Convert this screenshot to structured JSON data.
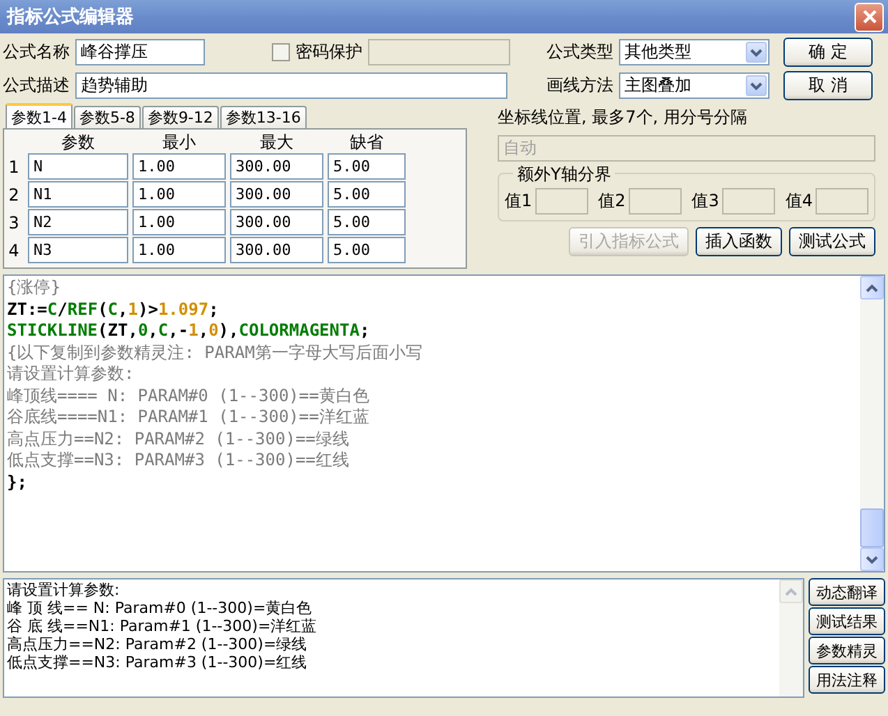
{
  "window": {
    "title": "指标公式编辑器"
  },
  "form": {
    "name_label": "公式名称",
    "name_value": "峰谷撑压",
    "password": {
      "label": "密码保护",
      "checked": false
    },
    "desc_label": "公式描述",
    "desc_value": "趋势辅助",
    "type_label": "公式类型",
    "type_value": "其他类型",
    "draw_label": "画线方法",
    "draw_value": "主图叠加"
  },
  "dialog_buttons": [
    "确 定",
    "取 消"
  ],
  "param_tabs": [
    {
      "label": "参数1-4",
      "selected": true
    },
    {
      "label": "参数5-8",
      "selected": false
    },
    {
      "label": "参数9-12",
      "selected": false
    },
    {
      "label": "参数13-16",
      "selected": false
    }
  ],
  "param_table": {
    "columns": [
      "参数",
      "最小",
      "最大",
      "缺省"
    ],
    "rows": [
      {
        "index": "1",
        "cells": [
          "N",
          "1.00",
          "300.00",
          "5.00"
        ]
      },
      {
        "index": "2",
        "cells": [
          "N1",
          "1.00",
          "300.00",
          "5.00"
        ]
      },
      {
        "index": "3",
        "cells": [
          "N2",
          "1.00",
          "300.00",
          "5.00"
        ]
      },
      {
        "index": "4",
        "cells": [
          "N3",
          "1.00",
          "300.00",
          "5.00"
        ]
      }
    ]
  },
  "axis": {
    "label": "坐标线位置, 最多7个, 用分号分隔",
    "value": "自动",
    "disabled": true
  },
  "y_bounds": {
    "title": "额外Y轴分界",
    "fields": [
      "值1",
      "值2",
      "值3",
      "值4"
    ]
  },
  "action_buttons": [
    {
      "label": "引入指标公式",
      "disabled": true
    },
    {
      "label": "插入函数",
      "disabled": false
    },
    {
      "label": "测试公式",
      "disabled": false
    }
  ],
  "editor": {
    "lines": [
      [
        {
          "kind": "comment",
          "text": "{涨停}"
        }
      ],
      [
        {
          "kind": "plain",
          "text": "ZT:="
        },
        {
          "kind": "keyword",
          "text": "C"
        },
        {
          "kind": "plain",
          "text": "/"
        },
        {
          "kind": "keyword",
          "text": "REF"
        },
        {
          "kind": "plain",
          "text": "("
        },
        {
          "kind": "keyword",
          "text": "C"
        },
        {
          "kind": "plain",
          "text": ","
        },
        {
          "kind": "number",
          "text": "1"
        },
        {
          "kind": "plain",
          "text": ")>"
        },
        {
          "kind": "number",
          "text": "1.097"
        },
        {
          "kind": "plain",
          "text": ";"
        }
      ],
      [
        {
          "kind": "keyword",
          "text": "STICKLINE"
        },
        {
          "kind": "plain",
          "text": "(ZT,"
        },
        {
          "kind": "keyword",
          "text": "0"
        },
        {
          "kind": "plain",
          "text": ","
        },
        {
          "kind": "keyword",
          "text": "C"
        },
        {
          "kind": "plain",
          "text": ",-"
        },
        {
          "kind": "number",
          "text": "1"
        },
        {
          "kind": "plain",
          "text": ","
        },
        {
          "kind": "number",
          "text": "0"
        },
        {
          "kind": "plain",
          "text": "),"
        },
        {
          "kind": "keyword",
          "text": "COLORMAGENTA"
        },
        {
          "kind": "plain",
          "text": ";"
        }
      ],
      [
        {
          "kind": "comment",
          "text": "{以下复制到参数精灵注: PARAM第一字母大写后面小写"
        }
      ],
      [
        {
          "kind": "comment",
          "text": "请设置计算参数:"
        }
      ],
      [
        {
          "kind": "comment",
          "text": "峰顶线==== N: PARAM#0 (1--300)==黄白色"
        }
      ],
      [
        {
          "kind": "comment",
          "text": "谷底线====N1: PARAM#1 (1--300)==洋红蓝"
        }
      ],
      [
        {
          "kind": "comment",
          "text": "高点压力==N2: PARAM#2 (1--300)==绿线"
        }
      ],
      [
        {
          "kind": "comment",
          "text": "低点支撑==N3: PARAM#3 (1--300)==红线"
        }
      ],
      [
        {
          "kind": "plain",
          "text": "};"
        }
      ]
    ]
  },
  "output": {
    "lines": [
      "请设置计算参数:",
      "峰 顶 线== N: Param#0 (1--300)=黄白色",
      "谷 底 线==N1: Param#1 (1--300)=洋红蓝",
      "高点压力==N2: Param#2 (1--300)=绿线",
      "低点支撑==N3: Param#3 (1--300)=红线"
    ]
  },
  "side_buttons": [
    "动态翻译",
    "测试结果",
    "参数精灵",
    "用法注释"
  ]
}
